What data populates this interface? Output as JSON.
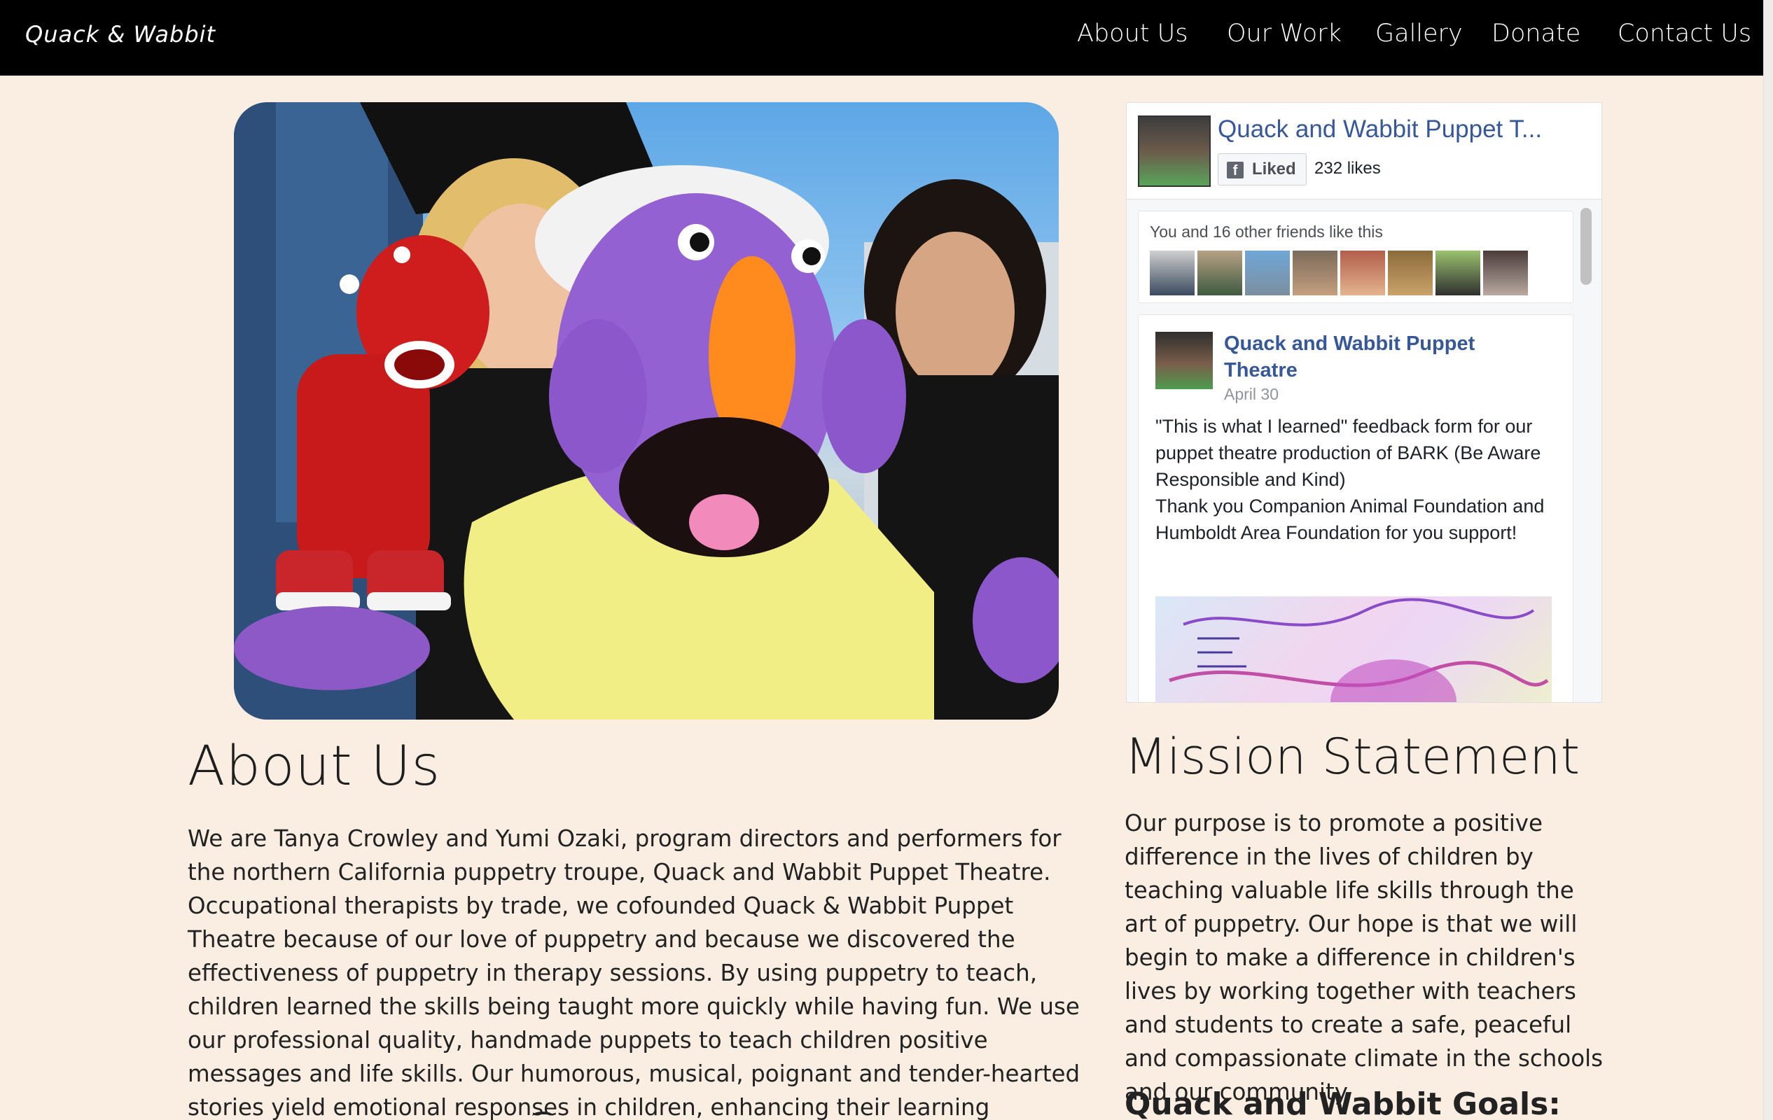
{
  "navbar": {
    "brand": "Quack & Wabbit",
    "items": [
      "About Us",
      "Our Work",
      "Gallery",
      "Donate",
      "Contact Us"
    ]
  },
  "hero": {
    "icon": "puppet-photo"
  },
  "facebook_widget": {
    "page_title": "Quack and Wabbit Puppet T...",
    "liked_label": "Liked",
    "likes": "232 likes",
    "friends_text": "You and 16 other friends like this",
    "post": {
      "author": "Quack and Wabbit Puppet Theatre",
      "date": "April 30",
      "text": "\"This is what I learned\" feedback form for our puppet theatre production of BARK (Be Aware Responsible and Kind)\nThank you Companion Animal Foundation and Humboldt Area Foundation for you support!"
    }
  },
  "about": {
    "title": "About Us",
    "text": "We are Tanya Crowley and Yumi Ozaki, program directors and performers for the northern California puppetry troupe, Quack and Wabbit Puppet Theatre. Occupational therapists by trade, we cofounded Quack & Wabbit Puppet Theatre because of our love of puppetry and because we discovered the effectiveness of puppetry in therapy sessions. By using puppetry to teach, children learned the skills being taught more quickly while having fun. We use our professional quality, handmade puppets to teach children positive messages and life skills. Our humorous, musical, poignant and tender-hearted stories yield emotional responses in children, enhancing their learning experience."
  },
  "mission": {
    "title": "Mission Statement",
    "text": "Our purpose is to promote a positive difference in the lives of children by teaching valuable life skills through the art of puppetry. Our hope is that we will begin to make a difference in children's lives by working together with teachers and students to create a safe, peaceful and compassionate climate in the schools and our community.",
    "goals_title": "Quack and Wabbit Goals:"
  }
}
